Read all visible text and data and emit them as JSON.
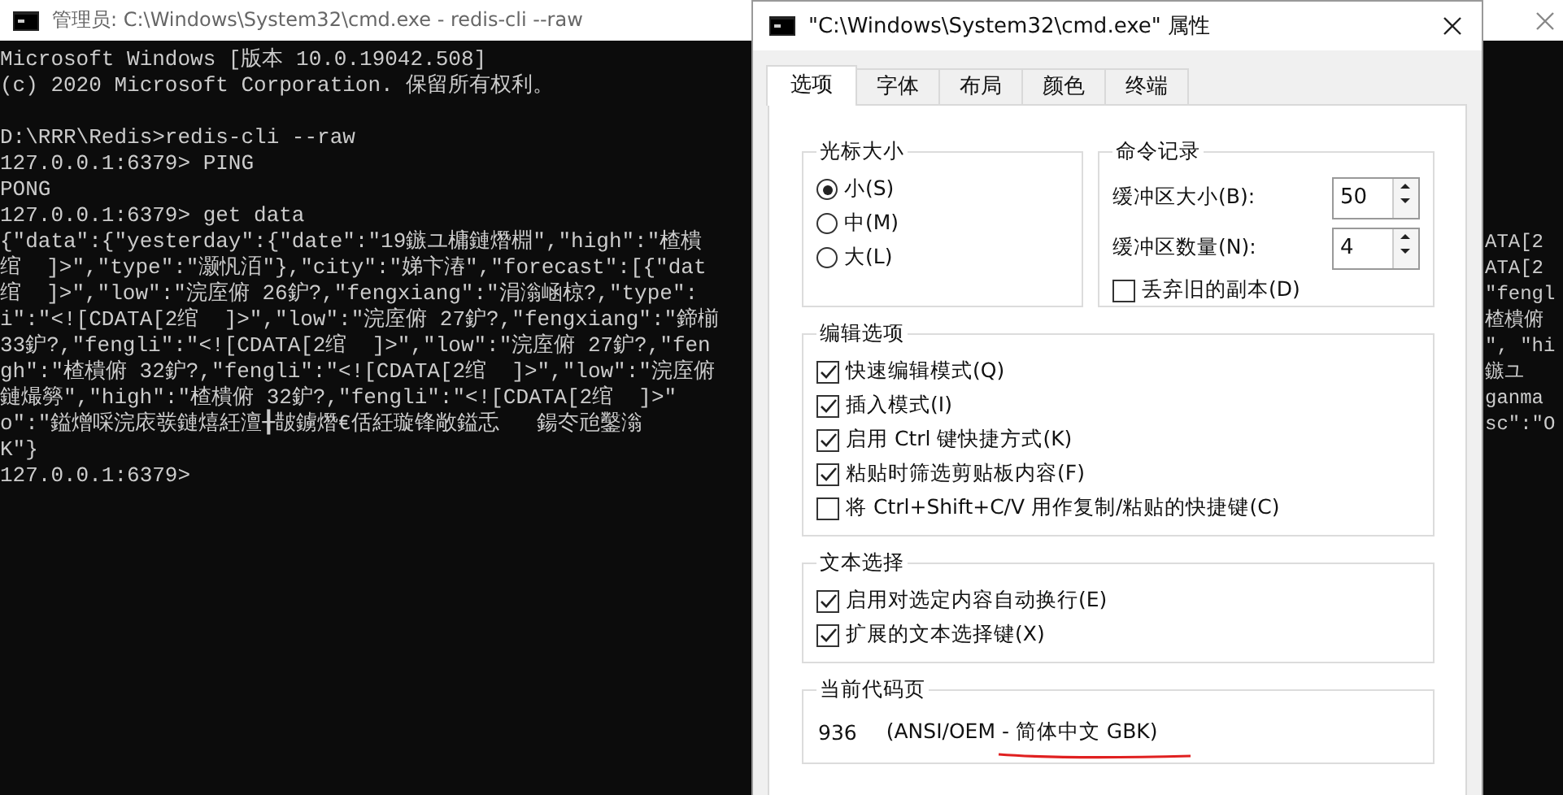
{
  "terminal": {
    "title": "管理员: C:\\Windows\\System32\\cmd.exe - redis-cli  --raw",
    "lines": [
      {
        "kind": "text",
        "text": "Microsoft Windows [版本 10.0.19042.508]"
      },
      {
        "kind": "text",
        "text": "(c) 2020 Microsoft Corporation. 保留所有权利。"
      },
      {
        "kind": "blank"
      },
      {
        "kind": "text",
        "text": "D:\\RRR\\Redis>redis-cli --raw"
      },
      {
        "kind": "text",
        "text": "127.0.0.1:6379> PING"
      },
      {
        "kind": "text",
        "text": "PONG"
      },
      {
        "kind": "text",
        "text": "127.0.0.1:6379> get data"
      },
      {
        "kind": "text",
        "text": "{\"data\":{\"yesterday\":{\"date\":\"19鏃ユ槦鏈熸棩\",\"high\":\"楂樻",
        "right": "ATA[2"
      },
      {
        "kind": "text",
        "text": "绾  ]>\",\"type\":\"灏忛洦\"},\"city\":\"娣卞湷\",\"forecast\":[{\"dat",
        "right": "ATA[2"
      },
      {
        "kind": "text",
        "text": "绾  ]>\",\"low\":\"浣庢俯 26鈩?,\"fengxiang\":\"涓滃崡椋?,\"type\":",
        "right": "\"fengl"
      },
      {
        "kind": "text",
        "text": "i\":\"<![CDATA[2绾  ]>\",\"low\":\"浣庢俯 27鈩?,\"fengxiang\":\"鍗椾",
        "right": "楂樻俯"
      },
      {
        "kind": "text",
        "text": "33鈩?,\"fengli\":\"<![CDATA[2绾  ]>\",\"low\":\"浣庢俯 27鈩?,\"fen",
        "right": "\", \"hi"
      },
      {
        "kind": "text",
        "text": "gh\":\"楂樻俯 32鈩?,\"fengli\":\"<![CDATA[2绾  ]>\",\"low\":\"浣庢俯",
        "right": "鏃ユ"
      },
      {
        "kind": "text",
        "text": "鏈熶簩\",\"high\":\"楂樻俯 32鈩?,\"fengli\":\"<![CDATA[2绾  ]>\"",
        "right": "ganma"
      },
      {
        "kind": "text",
        "text": "o\":\"鎰熷啋浣庡彂鏈熺紝澶╂皵鐪熸€佸紝璇锋敞鎰忎   鍚冭兘鑿滃",
        "right": "sc\":\"O"
      },
      {
        "kind": "text",
        "text": "K\"}"
      },
      {
        "kind": "text",
        "text": "127.0.0.1:6379>"
      }
    ]
  },
  "dialog": {
    "title": "\"C:\\Windows\\System32\\cmd.exe\" 属性",
    "tabs": [
      {
        "label": "选项",
        "selected": true
      },
      {
        "label": "字体",
        "selected": false
      },
      {
        "label": "布局",
        "selected": false
      },
      {
        "label": "颜色",
        "selected": false
      },
      {
        "label": "终端",
        "selected": false
      }
    ],
    "cursor_size": {
      "title": "光标大小",
      "options": [
        {
          "label": "小(S)",
          "selected": true
        },
        {
          "label": "中(M)",
          "selected": false
        },
        {
          "label": "大(L)",
          "selected": false
        }
      ]
    },
    "command_history": {
      "title": "命令记录",
      "fields": [
        {
          "label": "缓冲区大小(B):",
          "value": "50"
        },
        {
          "label": "缓冲区数量(N):",
          "value": "4"
        }
      ],
      "discard_old": {
        "label": "丢弃旧的副本(D)",
        "checked": false
      }
    },
    "edit_options": {
      "title": "编辑选项",
      "items": [
        {
          "label": "快速编辑模式(Q)",
          "checked": true
        },
        {
          "label": "插入模式(I)",
          "checked": true
        },
        {
          "label": "启用 Ctrl 键快捷方式(K)",
          "checked": true
        },
        {
          "label": "粘贴时筛选剪贴板内容(F)",
          "checked": true
        },
        {
          "label": "将 Ctrl+Shift+C/V 用作复制/粘贴的快捷键(C)",
          "checked": false
        }
      ]
    },
    "text_selection": {
      "title": "文本选择",
      "items": [
        {
          "label": "启用对选定内容自动换行(E)",
          "checked": true
        },
        {
          "label": "扩展的文本选择键(X)",
          "checked": true
        }
      ]
    },
    "code_page": {
      "title": "当前代码页",
      "number": "936",
      "name": "(ANSI/OEM - 简体中文 GBK)"
    }
  }
}
